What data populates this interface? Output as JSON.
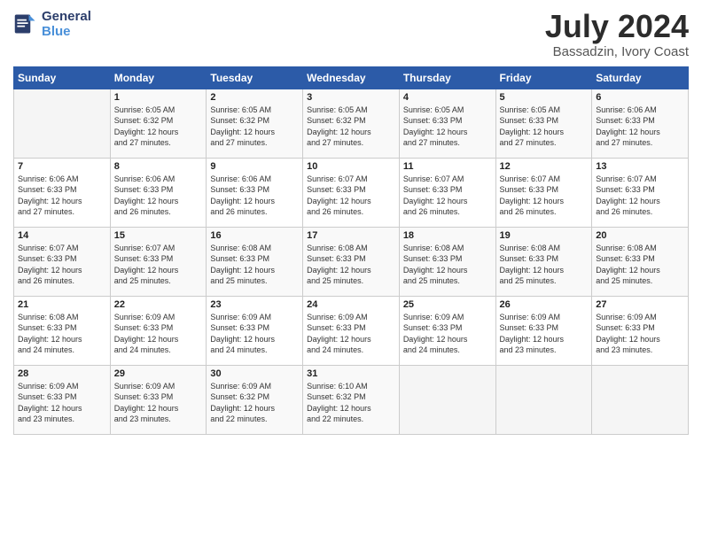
{
  "logo": {
    "line1": "General",
    "line2": "Blue"
  },
  "title": "July 2024",
  "location": "Bassadzin, Ivory Coast",
  "days_header": [
    "Sunday",
    "Monday",
    "Tuesday",
    "Wednesday",
    "Thursday",
    "Friday",
    "Saturday"
  ],
  "weeks": [
    [
      {
        "day": "",
        "info": ""
      },
      {
        "day": "1",
        "info": "Sunrise: 6:05 AM\nSunset: 6:32 PM\nDaylight: 12 hours\nand 27 minutes."
      },
      {
        "day": "2",
        "info": "Sunrise: 6:05 AM\nSunset: 6:32 PM\nDaylight: 12 hours\nand 27 minutes."
      },
      {
        "day": "3",
        "info": "Sunrise: 6:05 AM\nSunset: 6:32 PM\nDaylight: 12 hours\nand 27 minutes."
      },
      {
        "day": "4",
        "info": "Sunrise: 6:05 AM\nSunset: 6:33 PM\nDaylight: 12 hours\nand 27 minutes."
      },
      {
        "day": "5",
        "info": "Sunrise: 6:05 AM\nSunset: 6:33 PM\nDaylight: 12 hours\nand 27 minutes."
      },
      {
        "day": "6",
        "info": "Sunrise: 6:06 AM\nSunset: 6:33 PM\nDaylight: 12 hours\nand 27 minutes."
      }
    ],
    [
      {
        "day": "7",
        "info": "Sunrise: 6:06 AM\nSunset: 6:33 PM\nDaylight: 12 hours\nand 27 minutes."
      },
      {
        "day": "8",
        "info": "Sunrise: 6:06 AM\nSunset: 6:33 PM\nDaylight: 12 hours\nand 26 minutes."
      },
      {
        "day": "9",
        "info": "Sunrise: 6:06 AM\nSunset: 6:33 PM\nDaylight: 12 hours\nand 26 minutes."
      },
      {
        "day": "10",
        "info": "Sunrise: 6:07 AM\nSunset: 6:33 PM\nDaylight: 12 hours\nand 26 minutes."
      },
      {
        "day": "11",
        "info": "Sunrise: 6:07 AM\nSunset: 6:33 PM\nDaylight: 12 hours\nand 26 minutes."
      },
      {
        "day": "12",
        "info": "Sunrise: 6:07 AM\nSunset: 6:33 PM\nDaylight: 12 hours\nand 26 minutes."
      },
      {
        "day": "13",
        "info": "Sunrise: 6:07 AM\nSunset: 6:33 PM\nDaylight: 12 hours\nand 26 minutes."
      }
    ],
    [
      {
        "day": "14",
        "info": "Sunrise: 6:07 AM\nSunset: 6:33 PM\nDaylight: 12 hours\nand 26 minutes."
      },
      {
        "day": "15",
        "info": "Sunrise: 6:07 AM\nSunset: 6:33 PM\nDaylight: 12 hours\nand 25 minutes."
      },
      {
        "day": "16",
        "info": "Sunrise: 6:08 AM\nSunset: 6:33 PM\nDaylight: 12 hours\nand 25 minutes."
      },
      {
        "day": "17",
        "info": "Sunrise: 6:08 AM\nSunset: 6:33 PM\nDaylight: 12 hours\nand 25 minutes."
      },
      {
        "day": "18",
        "info": "Sunrise: 6:08 AM\nSunset: 6:33 PM\nDaylight: 12 hours\nand 25 minutes."
      },
      {
        "day": "19",
        "info": "Sunrise: 6:08 AM\nSunset: 6:33 PM\nDaylight: 12 hours\nand 25 minutes."
      },
      {
        "day": "20",
        "info": "Sunrise: 6:08 AM\nSunset: 6:33 PM\nDaylight: 12 hours\nand 25 minutes."
      }
    ],
    [
      {
        "day": "21",
        "info": "Sunrise: 6:08 AM\nSunset: 6:33 PM\nDaylight: 12 hours\nand 24 minutes."
      },
      {
        "day": "22",
        "info": "Sunrise: 6:09 AM\nSunset: 6:33 PM\nDaylight: 12 hours\nand 24 minutes."
      },
      {
        "day": "23",
        "info": "Sunrise: 6:09 AM\nSunset: 6:33 PM\nDaylight: 12 hours\nand 24 minutes."
      },
      {
        "day": "24",
        "info": "Sunrise: 6:09 AM\nSunset: 6:33 PM\nDaylight: 12 hours\nand 24 minutes."
      },
      {
        "day": "25",
        "info": "Sunrise: 6:09 AM\nSunset: 6:33 PM\nDaylight: 12 hours\nand 24 minutes."
      },
      {
        "day": "26",
        "info": "Sunrise: 6:09 AM\nSunset: 6:33 PM\nDaylight: 12 hours\nand 23 minutes."
      },
      {
        "day": "27",
        "info": "Sunrise: 6:09 AM\nSunset: 6:33 PM\nDaylight: 12 hours\nand 23 minutes."
      }
    ],
    [
      {
        "day": "28",
        "info": "Sunrise: 6:09 AM\nSunset: 6:33 PM\nDaylight: 12 hours\nand 23 minutes."
      },
      {
        "day": "29",
        "info": "Sunrise: 6:09 AM\nSunset: 6:33 PM\nDaylight: 12 hours\nand 23 minutes."
      },
      {
        "day": "30",
        "info": "Sunrise: 6:09 AM\nSunset: 6:32 PM\nDaylight: 12 hours\nand 22 minutes."
      },
      {
        "day": "31",
        "info": "Sunrise: 6:10 AM\nSunset: 6:32 PM\nDaylight: 12 hours\nand 22 minutes."
      },
      {
        "day": "",
        "info": ""
      },
      {
        "day": "",
        "info": ""
      },
      {
        "day": "",
        "info": ""
      }
    ]
  ]
}
